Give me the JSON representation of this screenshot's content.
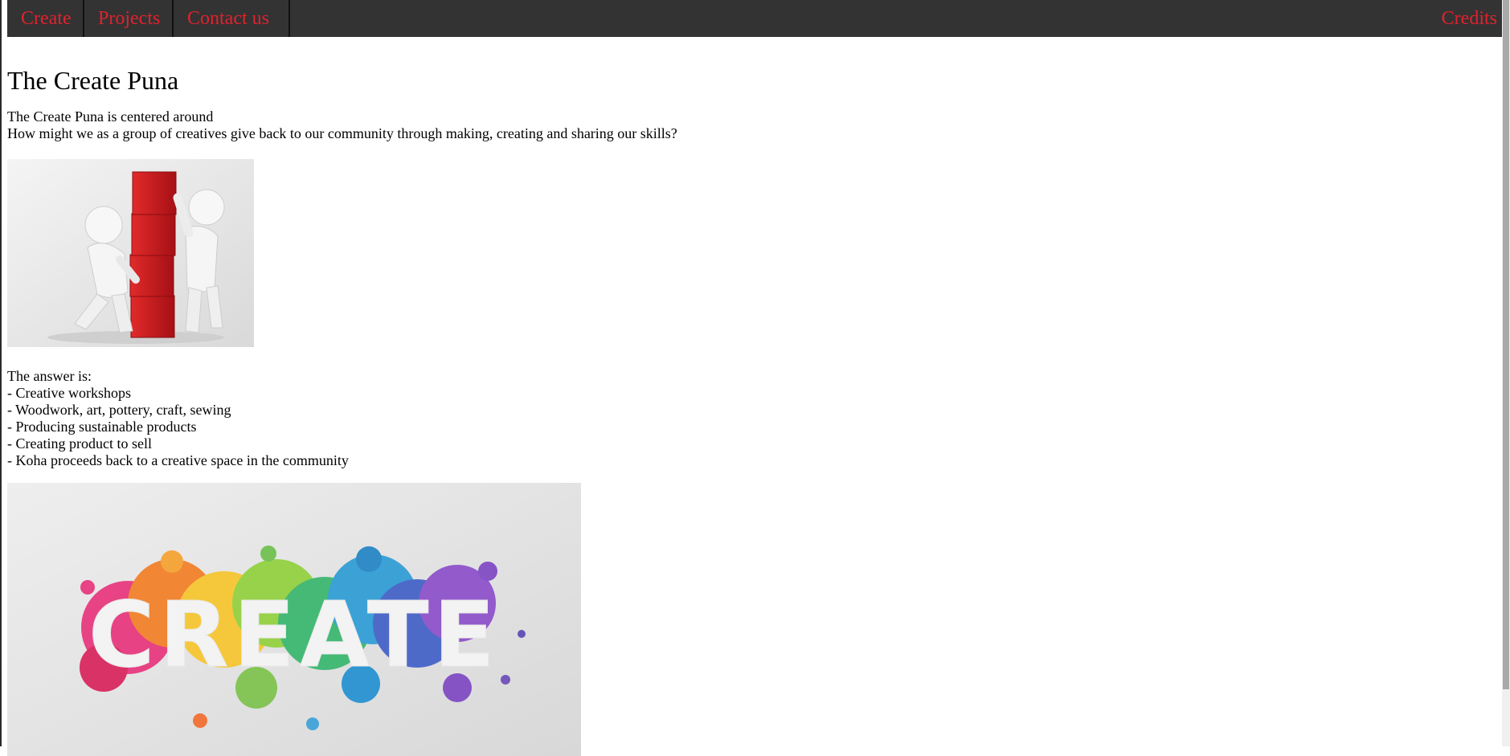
{
  "nav": {
    "create": "Create",
    "projects": "Projects",
    "contact": "Contact us",
    "credits": "Credits"
  },
  "colors": {
    "navbar_bg": "#333333",
    "nav_link": "#e0222d",
    "block_red": "#cc1e22"
  },
  "page": {
    "title": "The Create Puna",
    "intro_line1": "The Create Puna is centered around",
    "intro_line2": "How might we as a group of creatives give back to our community through making, creating and sharing our skills?",
    "answer_heading": "The answer is:",
    "answers": [
      "- Creative workshops",
      "- Woodwork, art, pottery, craft, sewing",
      "- Producing sustainable products",
      "- Creating product to sell",
      "- Koha proceeds back to a creative space in the community"
    ],
    "image2_word": "CREATE"
  }
}
